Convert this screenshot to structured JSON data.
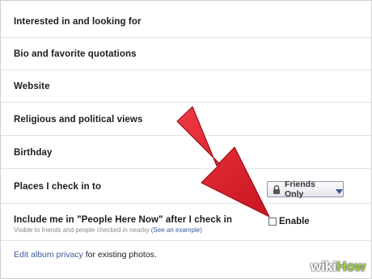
{
  "rows": [
    {
      "label": "Interested in and looking for"
    },
    {
      "label": "Bio and favorite quotations"
    },
    {
      "label": "Website"
    },
    {
      "label": "Religious and political views"
    },
    {
      "label": "Birthday"
    },
    {
      "label": "Places I check in to"
    },
    {
      "label": "Include me in \"People Here Now\" after I check in"
    }
  ],
  "people_here_now": {
    "hint": "Visible to friends and people checked in nearby",
    "example_link": "(See an example)",
    "enable_label": "Enable",
    "enabled": false
  },
  "privacy_dropdown": {
    "selected": "Friends Only",
    "lock_icon": "lock-icon",
    "caret_icon": "chevron-down-icon"
  },
  "footer": {
    "link": "Edit album privacy",
    "text": " for existing photos."
  },
  "watermark": {
    "prefix": "wiki",
    "suffix": "How"
  },
  "colors": {
    "arrow": "#e2232f",
    "link": "#3b5998",
    "watermark_accent": "#9ccf47"
  }
}
